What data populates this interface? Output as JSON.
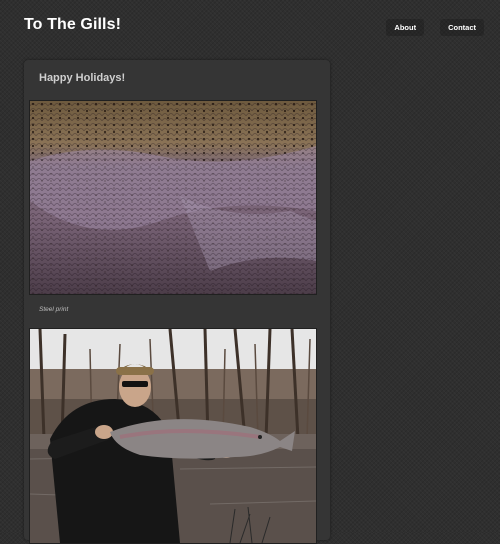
{
  "site": {
    "title": "To The Gills!"
  },
  "nav": {
    "items": [
      {
        "label": "About"
      },
      {
        "label": "Contact"
      }
    ]
  },
  "post": {
    "title": "Happy Holidays!",
    "photos": [
      {
        "caption": "Steel print"
      },
      {
        "caption": ""
      }
    ]
  }
}
